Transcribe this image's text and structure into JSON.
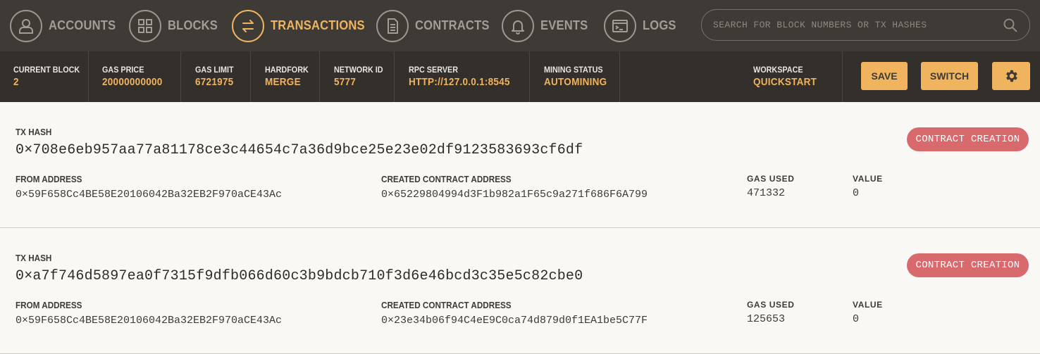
{
  "nav": {
    "items": [
      {
        "label": "ACCOUNTS",
        "icon": "account-icon"
      },
      {
        "label": "BLOCKS",
        "icon": "blocks-icon"
      },
      {
        "label": "TRANSACTIONS",
        "icon": "transactions-icon",
        "active": true
      },
      {
        "label": "CONTRACTS",
        "icon": "contracts-icon"
      },
      {
        "label": "EVENTS",
        "icon": "bell-icon"
      },
      {
        "label": "LOGS",
        "icon": "terminal-icon"
      }
    ],
    "search_placeholder": "SEARCH FOR BLOCK NUMBERS OR TX HASHES"
  },
  "status": {
    "current_block": {
      "label": "CURRENT BLOCK",
      "value": "2"
    },
    "gas_price": {
      "label": "GAS PRICE",
      "value": "20000000000"
    },
    "gas_limit": {
      "label": "GAS LIMIT",
      "value": "6721975"
    },
    "hardfork": {
      "label": "HARDFORK",
      "value": "MERGE"
    },
    "network_id": {
      "label": "NETWORK ID",
      "value": "5777"
    },
    "rpc_server": {
      "label": "RPC SERVER",
      "value": "HTTP://127.0.0.1:8545"
    },
    "mining_status": {
      "label": "MINING STATUS",
      "value": "AUTOMINING"
    },
    "workspace": {
      "label": "WORKSPACE",
      "value": "QUICKSTART"
    },
    "save_label": "SAVE",
    "switch_label": "SWITCH"
  },
  "transactions": [
    {
      "tx_hash_label": "TX HASH",
      "tx_hash": "0×708e6eb957aa77a81178ce3c44654c7a36d9bce25e23e02df9123583693cf6df",
      "badge": "CONTRACT CREATION",
      "from_label": "FROM ADDRESS",
      "from": "0×59F658Cc4BE58E20106042Ba32EB2F970aCE43Ac",
      "created_label": "CREATED CONTRACT ADDRESS",
      "created": "0×65229804994d3F1b982a1F65c9a271f686F6A799",
      "gas_used_label": "GAS USED",
      "gas_used": "471332",
      "value_label": "VALUE",
      "value": "0"
    },
    {
      "tx_hash_label": "TX HASH",
      "tx_hash": "0×a7f746d5897ea0f7315f9dfb066d60c3b9bdcb710f3d6e46bcd3c35e5c82cbe0",
      "badge": "CONTRACT CREATION",
      "from_label": "FROM ADDRESS",
      "from": "0×59F658Cc4BE58E20106042Ba32EB2F970aCE43Ac",
      "created_label": "CREATED CONTRACT ADDRESS",
      "created": "0×23e34b06f94C4eE9C0ca74d879d0f1EA1be5C77F",
      "gas_used_label": "GAS USED",
      "gas_used": "125653",
      "value_label": "VALUE",
      "value": "0"
    }
  ],
  "colors": {
    "nav_bg": "#3e3a36",
    "status_bg": "#332f2b",
    "accent": "#f0b45f",
    "badge": "#d86a6e",
    "content_bg": "#faf8f5"
  }
}
